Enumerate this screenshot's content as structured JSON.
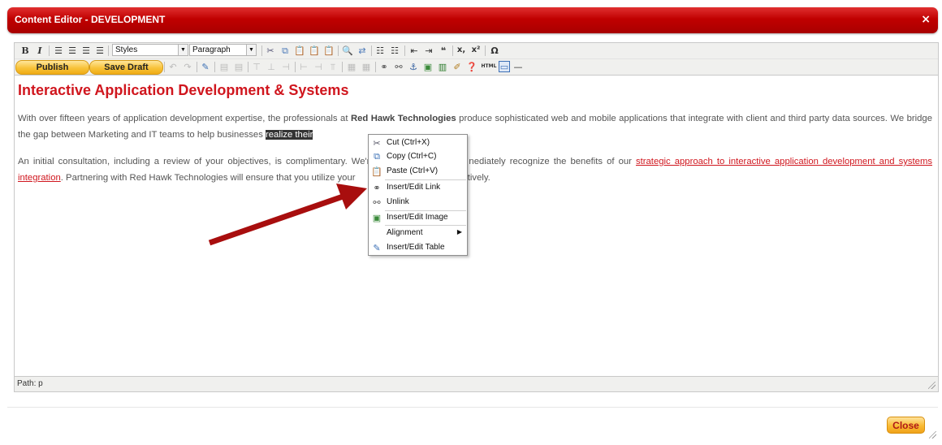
{
  "dialog": {
    "title": "Content Editor - DEVELOPMENT",
    "close_glyph": "×"
  },
  "toolbar1": {
    "bold": "B",
    "italic": "I",
    "styles_value": "Styles",
    "format_value": "Paragraph",
    "subscript": "x,",
    "superscript": "x²",
    "omega": "Ω"
  },
  "toolbar2": {
    "publish_label": "Publish",
    "save_draft_label": "Save Draft",
    "html_label": "HTML"
  },
  "content": {
    "heading": "Interactive Application Development & Systems",
    "p1_a": "With over fifteen years of application development expertise, the professionals at ",
    "p1_bold": "Red Hawk Technologies",
    "p1_b": " produce sophisticated web and mobile applications that integrate with client and third party data sources. We bridge the gap between Marketing and IT teams to help businesses ",
    "p1_highlight": "realize their",
    "p1_c": "",
    "p2_a": "An initial consultation, including a review of your objectives, is complimentary. We'r",
    "p2_b": "nediately recognize the benefits of our ",
    "p2_link": "strategic approach to interactive application development and systems integration",
    "p2_c": ". Partnering with Red Hawk Technologies will ensure that you utilize your",
    "p2_d": "effectively."
  },
  "path_bar": "Path: p",
  "context_menu": {
    "items": [
      {
        "label": "Cut (Ctrl+X)",
        "icon": "scissors-icon"
      },
      {
        "label": "Copy (Ctrl+C)",
        "icon": "copy-icon"
      },
      {
        "label": "Paste (Ctrl+V)",
        "icon": "paste-icon"
      },
      {
        "label": "Insert/Edit Link",
        "icon": "link-icon"
      },
      {
        "label": "Unlink",
        "icon": "unlink-icon"
      },
      {
        "label": "Insert/Edit Image",
        "icon": "image-icon"
      },
      {
        "label": "Alignment",
        "icon": ""
      },
      {
        "label": "Insert/Edit Table",
        "icon": "table-icon"
      }
    ]
  },
  "footer": {
    "close_label": "Close"
  },
  "colors": {
    "title_bar": "#c00000",
    "heading": "#d0161e",
    "button_gold": "#f8c33a",
    "arrow": "#a80e0e"
  }
}
